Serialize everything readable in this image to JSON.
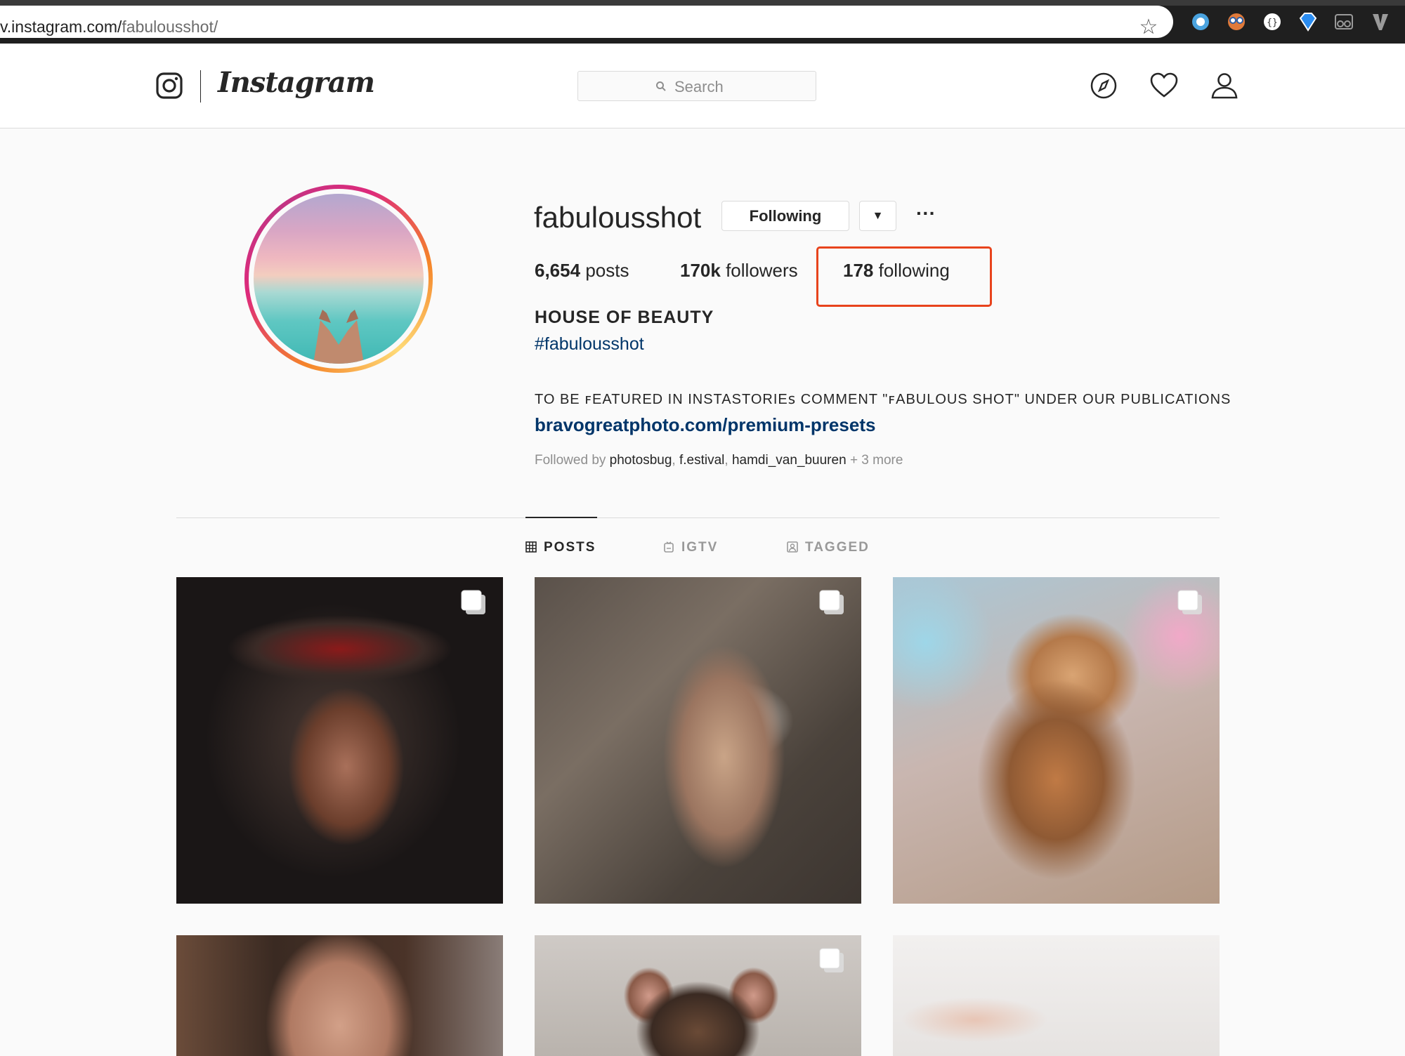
{
  "browser": {
    "url_host": "v.instagram.com/",
    "url_path": "fabulousshot/"
  },
  "header": {
    "wordmark": "Instagram",
    "search_placeholder": "Search"
  },
  "profile": {
    "username": "fabulousshot",
    "following_button": "Following",
    "posts_count": "6,654",
    "posts_label": "posts",
    "followers_count": "170k",
    "followers_label": "followers",
    "following_count": "178",
    "following_label": "following",
    "display_name": "HOUSE OF BEAUTY",
    "hashtag": "#fabulousshot",
    "bio": "TO BE ꜰEATURED IN INSTASTORIEꜱ COMMENT \"ꜰABULOUS SHOT\" UNDER OUR PUBLICATIONS",
    "link": "bravogreatphoto.com/premium-presets",
    "followed_by_prefix": "Followed by",
    "followed_by_users": [
      "photosbug",
      "f.estival",
      "hamdi_van_buuren"
    ],
    "followed_by_more": "+ 3 more"
  },
  "tabs": [
    {
      "label": "POSTS",
      "active": true
    },
    {
      "label": "IGTV",
      "active": false
    },
    {
      "label": "TAGGED",
      "active": false
    }
  ],
  "colors": {
    "highlight": "#e8431c",
    "link": "#003569"
  }
}
